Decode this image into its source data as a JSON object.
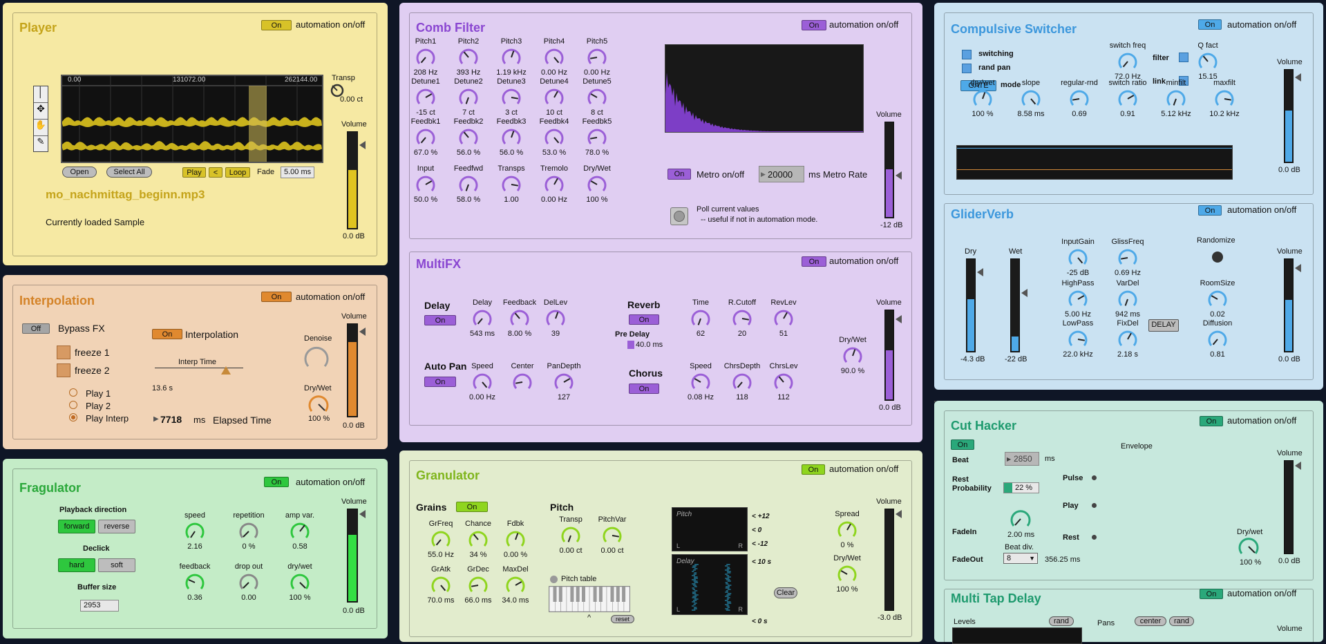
{
  "colors": {
    "player": "#f6e9a3",
    "interpolation": "#f1d3b6",
    "fragulator": "#c4ecc7",
    "comb": "#e0cef2",
    "granulator": "#e2eccd",
    "switcher": "#cae2f2",
    "cuthacker": "#c7e8dd",
    "accent_purple": "#9b5fd7",
    "accent_blue": "#4ea9e8",
    "accent_yellow": "#d8c228"
  },
  "automation_label": "automation on/off",
  "on": "On",
  "off": "Off",
  "player": {
    "title": "Player",
    "ticks": [
      "0.00",
      "131072.00",
      "262144.00"
    ],
    "transp_label": "Transp",
    "transp_value": "0.00 ct",
    "open": "Open",
    "select_all": "Select All",
    "play": "Play",
    "back": "<",
    "loop": "Loop",
    "fade_label": "Fade",
    "fade_value": "5.00 ms",
    "filename": "mo_nachmittag_beginn.mp3",
    "loaded": "Currently loaded Sample",
    "volume": "Volume",
    "volume_value": "0.0 dB",
    "volume_level": 0.6
  },
  "interpolation": {
    "title": "Interpolation",
    "bypass": "Bypass FX",
    "freeze1": "freeze 1",
    "freeze2": "freeze 2",
    "play1": "Play 1",
    "play2": "Play 2",
    "play_interp": "Play Interp",
    "interp_label": "Interpolation",
    "interp_time_label": "Interp Time",
    "interp_time_value": "13.6 s",
    "elapsed_value": "7718",
    "elapsed_unit": "ms",
    "elapsed_label": "Elapsed Time",
    "denoise": "Denoise",
    "drywet": "Dry/Wet",
    "drywet_value": "100 %",
    "volume": "Volume",
    "volume_value": "0.0 dB",
    "volume_level": 0.8
  },
  "fragulator": {
    "title": "Fragulator",
    "playback_direction": "Playback direction",
    "forward": "forward",
    "reverse": "reverse",
    "declick": "Declick",
    "hard": "hard",
    "soft": "soft",
    "buffer_size": "Buffer size",
    "buffer_value": "2953",
    "knobs": [
      {
        "label": "speed",
        "value": "2.16"
      },
      {
        "label": "repetition",
        "value": "0 %"
      },
      {
        "label": "amp var.",
        "value": "0.58"
      },
      {
        "label": "feedback",
        "value": "0.36"
      },
      {
        "label": "drop out",
        "value": "0.00"
      },
      {
        "label": "dry/wet",
        "value": "100 %"
      }
    ],
    "volume": "Volume",
    "volume_value": "0.0 dB",
    "volume_level": 0.72
  },
  "comb": {
    "title": "Comb Filter",
    "rows": [
      [
        {
          "label": "Pitch1",
          "value": "208 Hz"
        },
        {
          "label": "Pitch2",
          "value": "393 Hz"
        },
        {
          "label": "Pitch3",
          "value": "1.19 kHz"
        },
        {
          "label": "Pitch4",
          "value": "0.00 Hz"
        },
        {
          "label": "Pitch5",
          "value": "0.00 Hz"
        }
      ],
      [
        {
          "label": "Detune1",
          "value": "-15 ct"
        },
        {
          "label": "Detune2",
          "value": "7 ct"
        },
        {
          "label": "Detune3",
          "value": "3 ct"
        },
        {
          "label": "Detune4",
          "value": "10 ct"
        },
        {
          "label": "Detune5",
          "value": "8 ct"
        }
      ],
      [
        {
          "label": "Feedbk1",
          "value": "67.0 %"
        },
        {
          "label": "Feedbk2",
          "value": "56.0 %"
        },
        {
          "label": "Feedbk3",
          "value": "56.0 %"
        },
        {
          "label": "Feedbk4",
          "value": "53.0 %"
        },
        {
          "label": "Feedbk5",
          "value": "78.0 %"
        }
      ],
      [
        {
          "label": "Input",
          "value": "50.0 %"
        },
        {
          "label": "Feedfwd",
          "value": "58.0 %"
        },
        {
          "label": "Transps",
          "value": "1.00"
        },
        {
          "label": "Tremolo",
          "value": "0.00 Hz"
        },
        {
          "label": "Dry/Wet",
          "value": "100 %"
        }
      ]
    ],
    "metro": "Metro on/off",
    "metro_value": "20000",
    "metro_rate": "ms Metro Rate",
    "poll1": "Poll current values",
    "poll2": "-- useful if not in automation mode.",
    "volume": "Volume",
    "volume_value": "-12 dB",
    "volume_level": 0.5
  },
  "multifx": {
    "title": "MultiFX",
    "delay": "Delay",
    "autopan": "Auto Pan",
    "reverb": "Reverb",
    "pre_delay": "Pre Delay",
    "pre_delay_value": "40.0 ms",
    "chorus": "Chorus",
    "knobs": [
      {
        "label": "Delay",
        "value": "543 ms"
      },
      {
        "label": "Feedback",
        "value": "8.00 %"
      },
      {
        "label": "DelLev",
        "value": "39"
      },
      {
        "label": "Speed",
        "value": "0.00 Hz"
      },
      {
        "label": "Center",
        "value": ""
      },
      {
        "label": "PanDepth",
        "value": "127"
      },
      {
        "label": "Time",
        "value": "62"
      },
      {
        "label": "R.Cutoff",
        "value": "20"
      },
      {
        "label": "RevLev",
        "value": "51"
      },
      {
        "label": "Speed",
        "value": "0.08 Hz"
      },
      {
        "label": "ChrsDepth",
        "value": "118"
      },
      {
        "label": "ChrsLev",
        "value": "112"
      },
      {
        "label": "Dry/Wet",
        "value": "90.0 %"
      }
    ],
    "volume": "Volume",
    "volume_value": "0.0 dB",
    "volume_level": 0.55
  },
  "granulator": {
    "title": "Granulator",
    "grains": "Grains",
    "pitch": "Pitch",
    "knobs": [
      {
        "label": "GrFreq",
        "value": "55.0 Hz"
      },
      {
        "label": "Chance",
        "value": "34 %"
      },
      {
        "label": "Fdbk",
        "value": "0.00 %"
      },
      {
        "label": "GrAtk",
        "value": "70.0 ms"
      },
      {
        "label": "GrDec",
        "value": "66.0 ms"
      },
      {
        "label": "MaxDel",
        "value": "34.0 ms"
      },
      {
        "label": "Transp",
        "value": "0.00 ct"
      },
      {
        "label": "PitchVar",
        "value": "0.00 ct"
      },
      {
        "label": "Spread",
        "value": "0 %"
      },
      {
        "label": "Dry/Wet",
        "value": "100 %"
      }
    ],
    "pitch_table": "Pitch table",
    "reset": "reset",
    "caret": "^",
    "pitch_display": "Pitch",
    "delay_display": "Delay",
    "l": "L",
    "r": "R",
    "scale_p12": "< +12",
    "scale_0": "< 0",
    "scale_m12": "< -12",
    "scale_10s": "< 10 s",
    "scale_0s": "< 0 s",
    "clear": "Clear",
    "volume": "Volume",
    "volume_value": "-3.0 dB",
    "volume_level": 0.0
  },
  "switcher": {
    "title": "Compulsive Switcher",
    "switching": "switching",
    "rand_pan": "rand pan",
    "gate": "GATE",
    "mode": "mode",
    "filter": "filter",
    "link": "link",
    "knobs": [
      {
        "label": "switch freq",
        "value": "72.0 Hz"
      },
      {
        "label": "Q fact",
        "value": "15.15"
      },
      {
        "label": "dry/wet",
        "value": "100 %"
      },
      {
        "label": "slope",
        "value": "8.58 ms"
      },
      {
        "label": "regular-rnd",
        "value": "0.69"
      },
      {
        "label": "switch ratio",
        "value": "0.91"
      },
      {
        "label": "minfilt",
        "value": "5.12 kHz"
      },
      {
        "label": "maxfilt",
        "value": "10.2 kHz"
      }
    ],
    "volume": "Volume",
    "volume_value": "0.0 dB",
    "volume_level": 0.55
  },
  "glider": {
    "title": "GliderVerb",
    "dry": "Dry",
    "dry_value": "-4.3 dB",
    "wet": "Wet",
    "wet_value": "-22 dB",
    "randomize": "Randomize",
    "delay_btn": "DELAY",
    "knobs": [
      {
        "label": "InputGain",
        "value": "-25 dB"
      },
      {
        "label": "GlissFreq",
        "value": "0.69 Hz"
      },
      {
        "label": "HighPass",
        "value": "5.00 Hz"
      },
      {
        "label": "VarDel",
        "value": "942 ms"
      },
      {
        "label": "LowPass",
        "value": "22.0 kHz"
      },
      {
        "label": "FixDel",
        "value": "2.18 s"
      },
      {
        "label": "RoomSize",
        "value": "0.02"
      },
      {
        "label": "Diffusion",
        "value": "0.81"
      }
    ],
    "volume": "Volume",
    "volume_value": "0.0 dB",
    "volume_level": 0.55
  },
  "cuthacker": {
    "title": "Cut Hacker",
    "beat": "Beat",
    "beat_value": "2850",
    "beat_unit": "ms",
    "rest_probability1": "Rest",
    "rest_probability2": "Probability",
    "rest_value": "22 %",
    "fadein": "FadeIn",
    "fadein_value": "2.00 ms",
    "fadeout": "FadeOut",
    "beat_div": "Beat div.",
    "beat_div_value": "8",
    "fadeout_value": "356.25 ms",
    "pulse": "Pulse",
    "play": "Play",
    "rest": "Rest",
    "envelope": "Envelope",
    "drywet": "Dry/wet",
    "drywet_value": "100 %",
    "volume": "Volume",
    "volume_value": "0.0 dB"
  },
  "multitap": {
    "title": "Multi Tap Delay",
    "levels": "Levels",
    "pans": "Pans",
    "rand": "rand",
    "center": "center",
    "volume": "Volume"
  }
}
